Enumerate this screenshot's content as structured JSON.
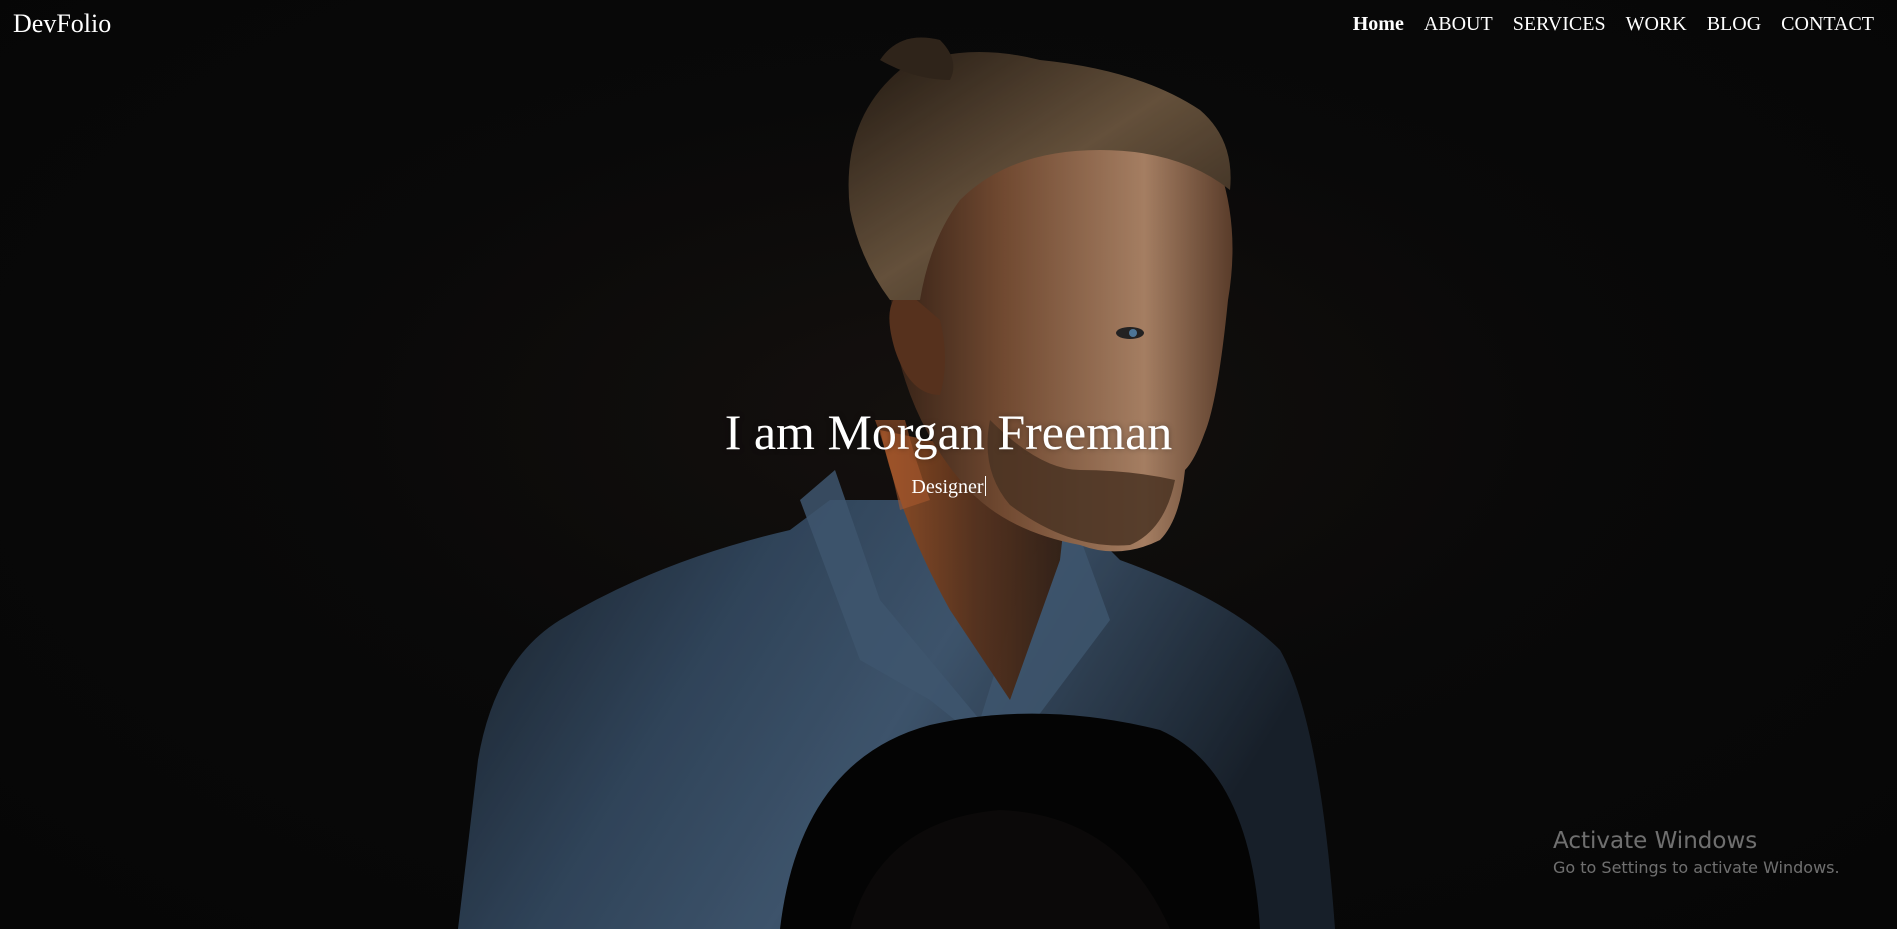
{
  "navbar": {
    "brand": "DevFolio",
    "items": [
      {
        "label": "Home",
        "active": true
      },
      {
        "label": "ABOUT",
        "active": false
      },
      {
        "label": "SERVICES",
        "active": false
      },
      {
        "label": "WORK",
        "active": false
      },
      {
        "label": "BLOG",
        "active": false
      },
      {
        "label": "CONTACT",
        "active": false
      }
    ]
  },
  "hero": {
    "title": "I am Morgan Freeman",
    "subtitle": "Designer"
  },
  "watermark": {
    "title": "Activate Windows",
    "subtitle": "Go to Settings to activate Windows."
  },
  "colors": {
    "background": "#0a0a0a",
    "text": "#ffffff",
    "shirt": "#3e5873",
    "skin_highlight": "#c98a5e"
  }
}
